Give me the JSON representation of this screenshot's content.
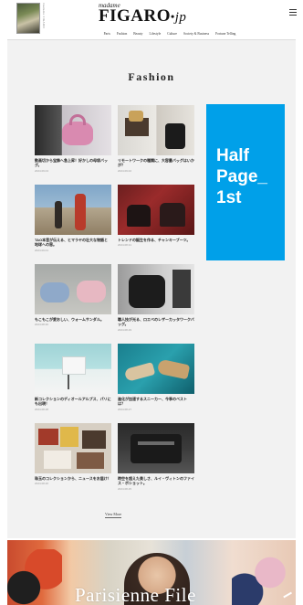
{
  "header": {
    "logo_prefix": "madame",
    "logo_main": "FIGARO",
    "logo_suffix": "jp",
    "nav": [
      "Paris",
      "Fashion",
      "Beauty",
      "Lifestyle",
      "Culture",
      "Society & Business",
      "Fortune Telling"
    ]
  },
  "section": {
    "title": "Fashion"
  },
  "articles": [
    {
      "caption": "動画切から宝飾へ急上昇！好かしの母袋バッグ。",
      "date": "2024.09.04"
    },
    {
      "caption": "リモートワークの種類に、大容量バッグはいかが？",
      "date": "2024.09.02"
    },
    {
      "caption": "TAO本音が伝える、ヒマラヤの壮大な物語と地球への恩。",
      "date": "2024.09.01"
    },
    {
      "caption": "トレンドの誕生を作る、チャンキーブーツ。",
      "date": "2024.08.31"
    },
    {
      "caption": "もこもこが愛おしい、ウォームサンダル。",
      "date": "2024.08.30"
    },
    {
      "caption": "職人技が光る、ロエベのレザーカッタワークバッグ。",
      "date": "2024.08.29"
    },
    {
      "caption": "新コレクションのディオールアルプス、パリにも出現！",
      "date": "2024.08.28"
    },
    {
      "caption": "進化が加速するスニーカー、今季のベストは？",
      "date": "2024.08.27"
    },
    {
      "caption": "珠玉のコレクションから、ニュースをお届け！",
      "date": "2024.08.26"
    },
    {
      "caption": "時空を超えた美しさ、ルイ・ヴィトンのファイス・ボショット。",
      "date": "2024.08.25"
    }
  ],
  "view_more": "View More",
  "ad": {
    "text": "Half\nPage_\n1st"
  },
  "banner": {
    "title": "Parisienne File"
  },
  "colors": {
    "ad_blue": "#00a0e9",
    "content_bg": "#f2f2f2"
  }
}
